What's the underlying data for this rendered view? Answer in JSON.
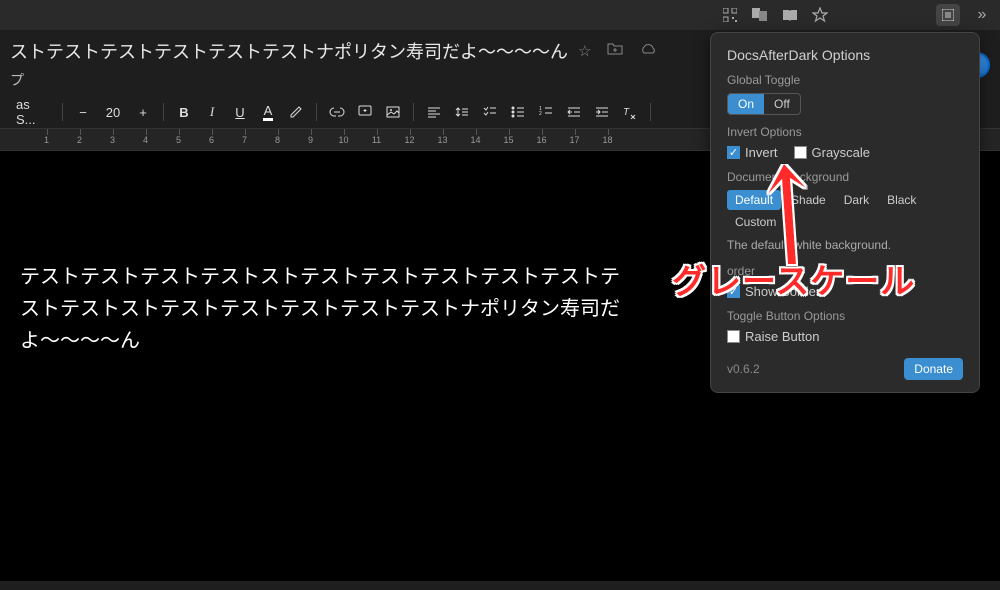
{
  "browser": {
    "icons": [
      "qr-icon",
      "translate-icon",
      "book-icon",
      "star-icon",
      "extensions-icon",
      "more-icon"
    ]
  },
  "doc": {
    "title": "ストテストテストテストテストテストナポリタン寿司だよ〜〜〜〜ん",
    "subtitle": "プ"
  },
  "toolbar": {
    "font_name": "as S...",
    "font_dec": "−",
    "font_size": "20",
    "font_inc": "+",
    "bold": "B",
    "italic": "I",
    "underline": "U",
    "text_color": "A"
  },
  "ruler": {
    "marks": [
      "1",
      "2",
      "3",
      "4",
      "5",
      "6",
      "7",
      "8",
      "9",
      "10",
      "11",
      "12",
      "13",
      "14",
      "15",
      "16",
      "17",
      "18"
    ]
  },
  "page": {
    "body": "テストテストテストテストストテストテストテストテストテストテストテストストテストテストテストテストテストナポリタン寿司だよ〜〜〜〜ん"
  },
  "popup": {
    "title": "DocsAfterDark Options",
    "global_toggle_label": "Global Toggle",
    "on": "On",
    "off": "Off",
    "invert_label": "Invert Options",
    "invert": "Invert",
    "grayscale": "Grayscale",
    "docbg_label": "Document Background",
    "bg_default": "Default",
    "bg_shade": "Shade",
    "bg_dark": "Dark",
    "bg_black": "Black",
    "bg_custom": "Custom",
    "desc": "The default, white background.",
    "border_label_partial": "order",
    "show_border": "Show Border",
    "toggle_btn_label": "Toggle Button Options",
    "raise_button": "Raise Button",
    "version": "v0.6.2",
    "donate": "Donate"
  },
  "annotation": {
    "text": "グレースケール"
  }
}
